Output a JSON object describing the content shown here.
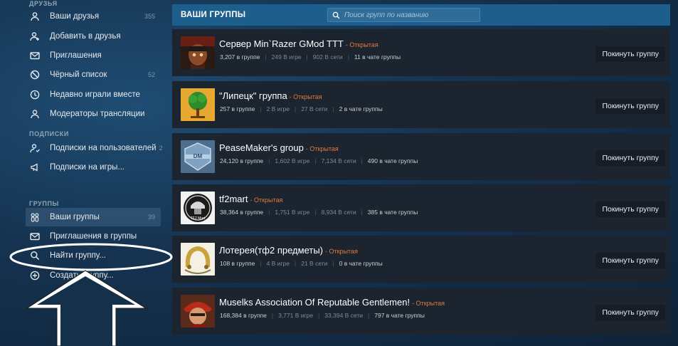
{
  "sidebar": {
    "friends_label": "ДРУЗЬЯ",
    "friends_items": [
      {
        "label": "Ваши друзья",
        "count": "355",
        "icon": "user-icon"
      },
      {
        "label": "Добавить в друзья",
        "count": "",
        "icon": "add-user-icon"
      },
      {
        "label": "Приглашения",
        "count": "",
        "icon": "envelope-icon"
      },
      {
        "label": "Чёрный список",
        "count": "52",
        "icon": "block-icon"
      },
      {
        "label": "Недавно играли вместе",
        "count": "",
        "icon": "clock-icon"
      },
      {
        "label": "Модераторы трансляции",
        "count": "",
        "icon": "user-icon"
      }
    ],
    "subs_label": "ПОДПИСКИ",
    "subs_items": [
      {
        "label": "Подписки на пользователей",
        "count": "2",
        "icon": "user-follow-icon"
      },
      {
        "label": "Подписки на игры...",
        "count": "",
        "icon": "megaphone-icon"
      }
    ],
    "groups_label": "ГРУППЫ",
    "groups_items": [
      {
        "label": "Ваши группы",
        "count": "39",
        "icon": "group-icon"
      },
      {
        "label": "Приглашения в группы",
        "count": "",
        "icon": "envelope-icon"
      },
      {
        "label": "Найти группу...",
        "count": "",
        "icon": "search-icon"
      },
      {
        "label": "Создать группу...",
        "count": "",
        "icon": "plus-circle-icon"
      }
    ]
  },
  "header": {
    "title": "ВАШИ ГРУППЫ",
    "search_placeholder": "Поиск групп по названию"
  },
  "groups": [
    {
      "name": "Сервер Min`Razer GMod TTT",
      "status": "- Открытая",
      "members": "3,207 в группе",
      "in_game": "249 В игре",
      "online": "902 В сети",
      "chat": "11 в чате группы",
      "leave": "Покинуть группу"
    },
    {
      "name": "\"Липецк\" группа",
      "status": "- Открытая",
      "members": "257 в группе",
      "in_game": "2 В игре",
      "online": "27 В сети",
      "chat": "2 в чате группы",
      "leave": "Покинуть группу"
    },
    {
      "name": "PeaseMaker's group",
      "status": "- Открытая",
      "members": "24,120 в группе",
      "in_game": "1,602 В игре",
      "online": "7,134 В сети",
      "chat": "490 в чате группы",
      "leave": "Покинуть группу"
    },
    {
      "name": "tf2mart",
      "status": "- Открытая",
      "members": "38,364 в группе",
      "in_game": "1,751 В игре",
      "online": "8,934 В сети",
      "chat": "385 в чате группы",
      "leave": "Покинуть группу"
    },
    {
      "name": "Лотерея(тф2 предметы)",
      "status": "- Открытая",
      "members": "108 в группе",
      "in_game": "4 В игре",
      "online": "21 В сети",
      "chat": "0 в чате группы",
      "leave": "Покинуть группу"
    },
    {
      "name": "Muselks Association Of Reputable Gentlemen!",
      "status": "- Открытая",
      "members": "168,384 в группе",
      "in_game": "3,771 В игре",
      "online": "33,394 В сети",
      "chat": "797 в чате группы",
      "leave": "Покинуть группу"
    }
  ],
  "avatars": {
    "tf2mart_label": "TF2 Mart"
  },
  "colors": {
    "header_bg": "#1e5e8c",
    "card_bg": "#1c2430",
    "status_orange": "#e07a3a"
  }
}
